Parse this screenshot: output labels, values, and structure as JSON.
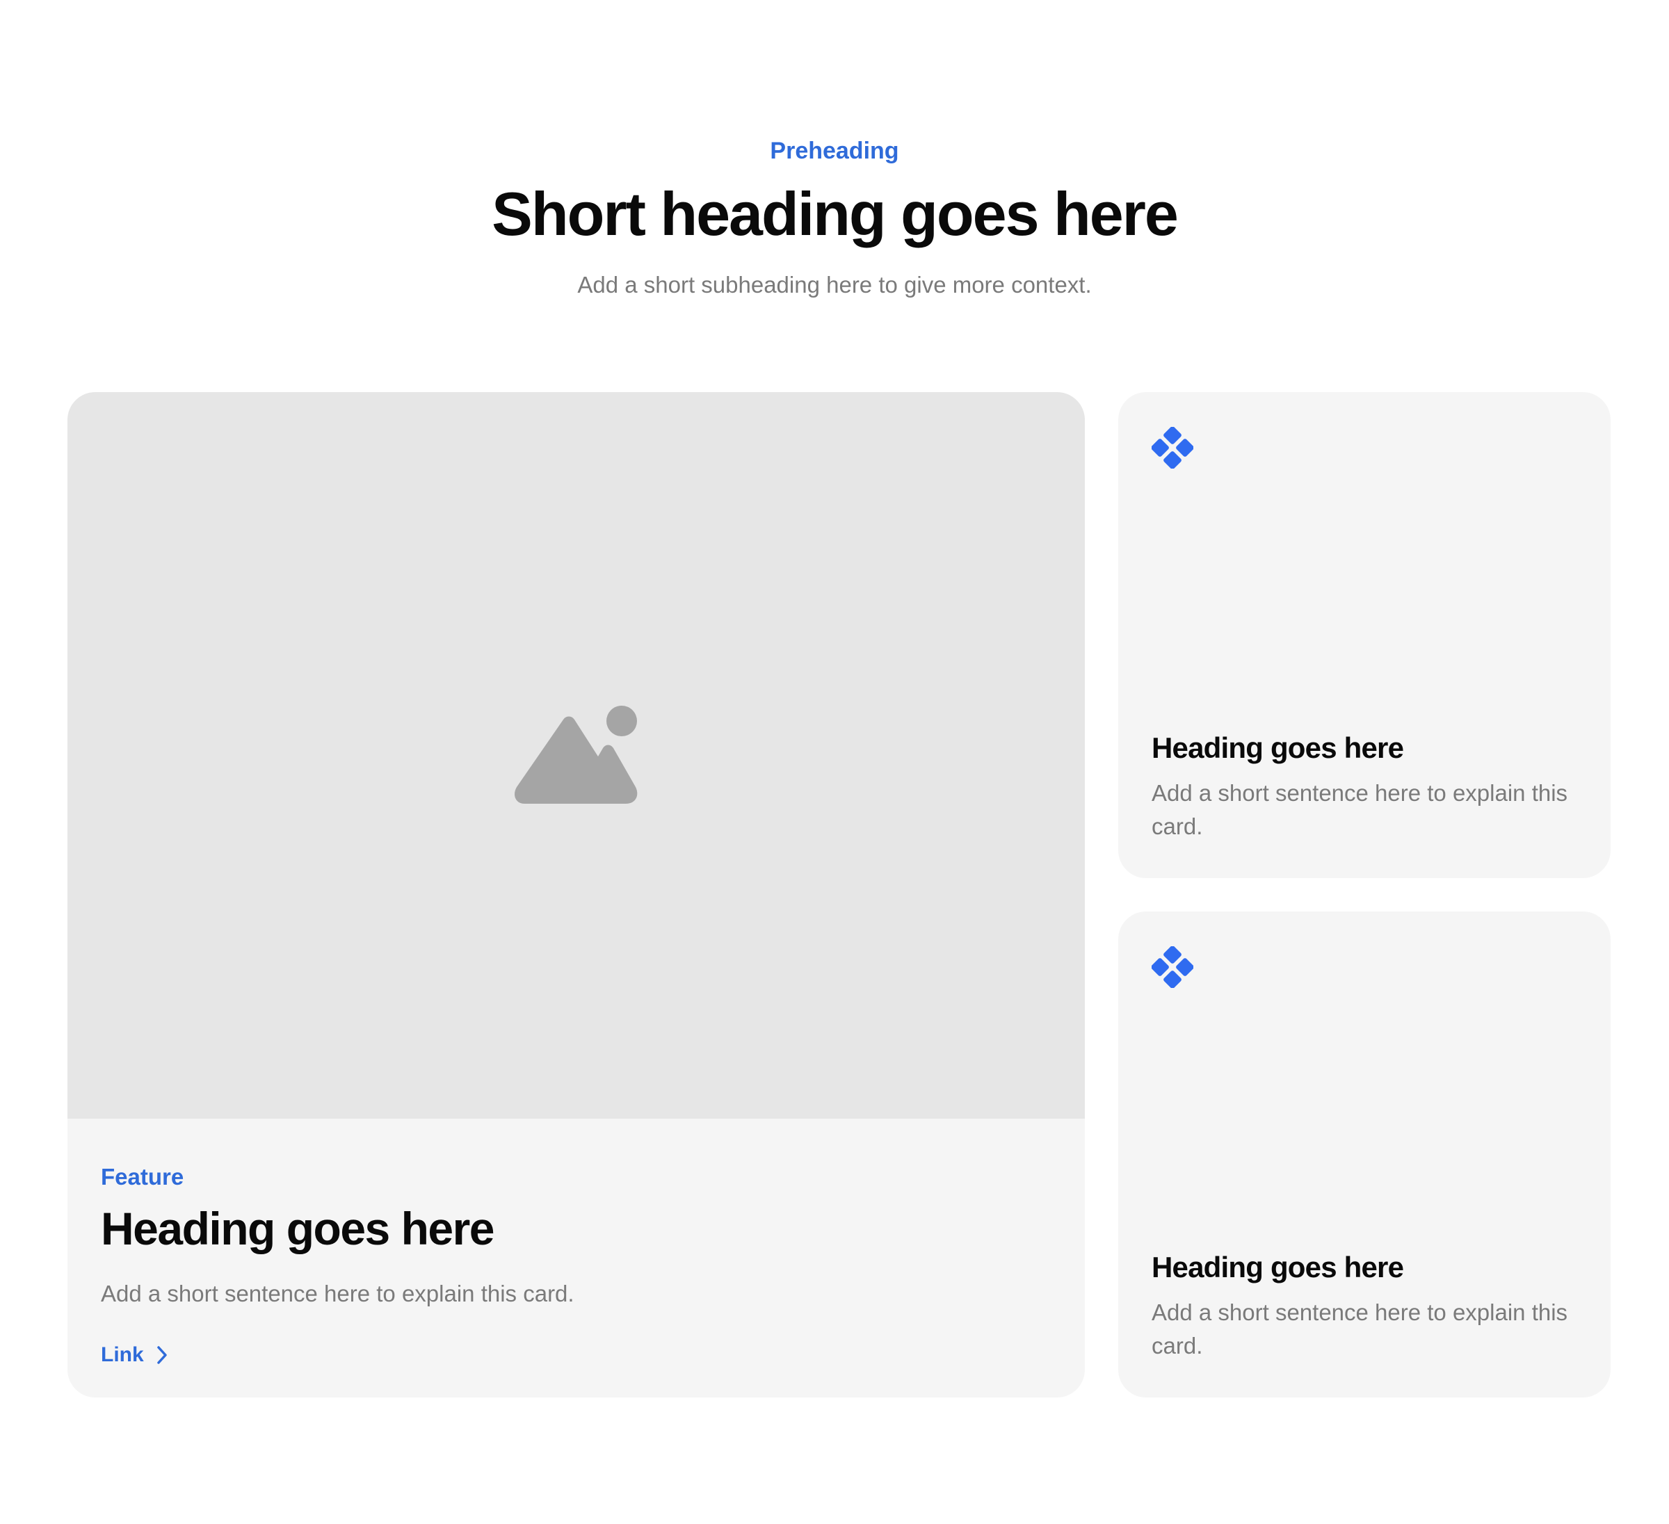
{
  "header": {
    "preheading": "Preheading",
    "title": "Short heading goes here",
    "subheading": "Add a short subheading here to give more context."
  },
  "feature_card": {
    "media_icon": "image-placeholder-icon",
    "tag": "Feature",
    "heading": "Heading goes here",
    "text": "Add a short sentence here to explain this card.",
    "link_label": "Link",
    "link_icon": "chevron-right-icon"
  },
  "side_cards": [
    {
      "icon": "diamond-cluster-icon",
      "heading": "Heading goes here",
      "text": "Add a short sentence here to explain this card."
    },
    {
      "icon": "diamond-cluster-icon",
      "heading": "Heading goes here",
      "text": "Add a short sentence here to explain this card."
    }
  ],
  "colors": {
    "accent": "#2f6bd9",
    "icon_blue": "#2f6bf0",
    "card_bg": "#f5f5f5",
    "media_bg": "#e6e6e6",
    "placeholder_icon": "#a5a5a5",
    "muted_text": "#7a7a7a"
  }
}
